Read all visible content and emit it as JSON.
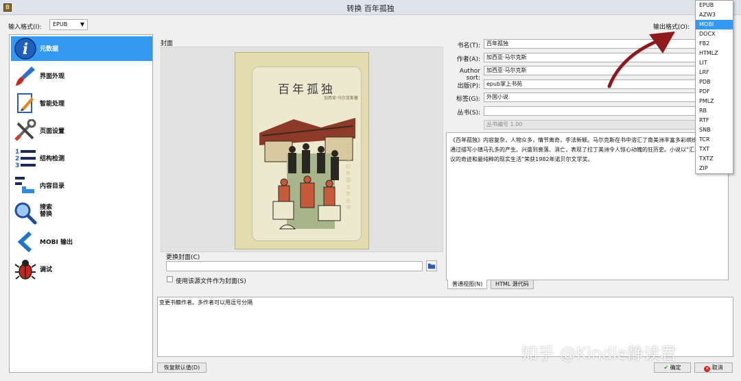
{
  "window": {
    "title": "转换 百年孤独",
    "icon_name": "calibre-app-icon"
  },
  "input_format": {
    "label": "输入格式(I):",
    "value": "EPUB"
  },
  "output_format": {
    "label": "输出格式(O):",
    "options": [
      "EPUB",
      "AZW3",
      "MOBI",
      "DOCX",
      "FB2",
      "HTMLZ",
      "LIT",
      "LRF",
      "PDB",
      "PDF",
      "PMLZ",
      "RB",
      "RTF",
      "SNB",
      "TCR",
      "TXT",
      "TXTZ",
      "ZIP"
    ],
    "highlighted": "MOBI"
  },
  "sidebar": {
    "items": [
      {
        "label": "元数据",
        "icon": "info-icon",
        "selected": true
      },
      {
        "label": "界面外观",
        "icon": "paintbrush-icon"
      },
      {
        "label": "智能处理",
        "icon": "pencil-document-icon"
      },
      {
        "label": "页面设置",
        "icon": "tools-icon"
      },
      {
        "label": "结构检测",
        "icon": "numbered-list-icon"
      },
      {
        "label": "内容目录",
        "icon": "toc-icon"
      },
      {
        "label": "搜索\n替换",
        "icon": "magnifier-icon"
      },
      {
        "label": "MOBI 输出",
        "icon": "chevron-left-icon"
      },
      {
        "label": "调试",
        "icon": "bug-icon"
      }
    ]
  },
  "cover": {
    "section_label": "封面",
    "book_title": "百年孤独",
    "book_subtitle": "加西亚·马尔克斯著",
    "side_text": "二十世纪外国文学丛书",
    "change_label": "更换封面(C)",
    "path_value": "",
    "use_source_label": "使用该源文件作为封面(S)"
  },
  "metadata": {
    "title_label": "书名(T):",
    "title": "百年孤独",
    "author_label": "作者(A):",
    "author": "加西亚·马尔克斯",
    "author_sort_label": "Author sort:",
    "author_sort": "加西亚·马尔克斯",
    "publisher_label": "出版(P):",
    "publisher": "epub掌上书苑",
    "tags_label": "标签(G):",
    "tags": "外国小说",
    "series_label": "丛书(S):",
    "series": "",
    "series_index": "丛书编号 1.00"
  },
  "comments": {
    "text": "《百年孤独》内容复杂，人物众多，情节离奇，手法新颖。马尔克斯在书中溶汇了南美洲丰富多彩缤纷的文化。他通过描写小镇马孔多的产生、兴盛到衰落、消亡，表现了拉丁美洲令人惊心动魄的狂历史。小说以“汇集了不可思议的奇迹和最纯粹的现实生活”荣获1982年诺贝尔文学奖。",
    "tab_normal": "普通视图(N)",
    "tab_html": "HTML 源代码"
  },
  "help_text": "变更书籍作者。多作者可以用逗号分隔",
  "buttons": {
    "restore": "恢复默认值(D)",
    "ok": "确定",
    "cancel": "取消"
  },
  "watermark": "知乎 @Kindle静读君",
  "colors": {
    "selection": "#3399f3",
    "ok_check": "#1a9e1a",
    "cancel_x": "#d0241a",
    "arrow": "#8e1a1e"
  }
}
